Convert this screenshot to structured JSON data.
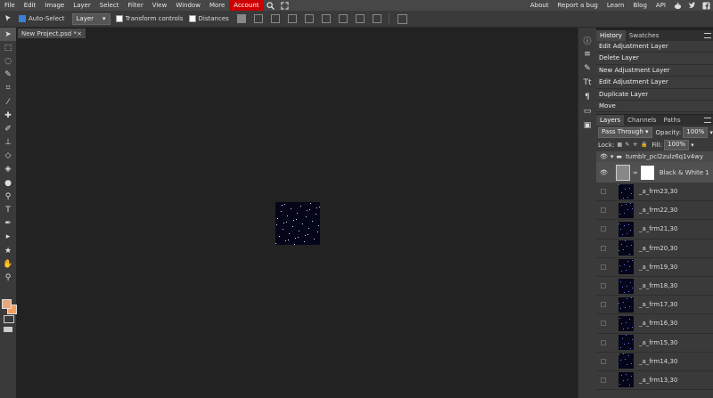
{
  "menubar": {
    "items": [
      "File",
      "Edit",
      "Image",
      "Layer",
      "Select",
      "Filter",
      "View",
      "Window",
      "More"
    ],
    "account": "Account",
    "right_links": [
      "About",
      "Report a bug",
      "Learn",
      "Blog",
      "API"
    ]
  },
  "optbar": {
    "auto_select": "Auto-Select",
    "layer_select": "Layer",
    "transform_controls": "Transform controls",
    "distances": "Distances"
  },
  "document": {
    "tab_title": "New Project.psd *",
    "close": "×"
  },
  "history": {
    "tabs": [
      "History",
      "Swatches"
    ],
    "items": [
      "Edit Adjustment Layer",
      "Delete Layer",
      "New Adjustment Layer",
      "Edit Adjustment Layer",
      "Duplicate Layer",
      "Move"
    ]
  },
  "layers_panel": {
    "tabs": [
      "Layers",
      "Channels",
      "Paths"
    ],
    "blend_mode": "Pass Through",
    "opacity_label": "Opacity:",
    "opacity_value": "100%",
    "lock_label": "Lock:",
    "fill_label": "Fill:",
    "fill_value": "100%",
    "group_name": "tumblr_pcl2zulz6q1v4wy",
    "adjustment_layer": "Black & White 1",
    "layers": [
      "_a_frm23,30",
      "_a_frm22,30",
      "_a_frm21,30",
      "_a_frm20,30",
      "_a_frm19,30",
      "_a_frm18,30",
      "_a_frm17,30",
      "_a_frm16,30",
      "_a_frm15,30",
      "_a_frm14,30",
      "_a_frm13,30"
    ]
  },
  "colors": {
    "foreground": "#e8a77c",
    "background": "#f2a060",
    "account_bg": "#cc0000"
  }
}
